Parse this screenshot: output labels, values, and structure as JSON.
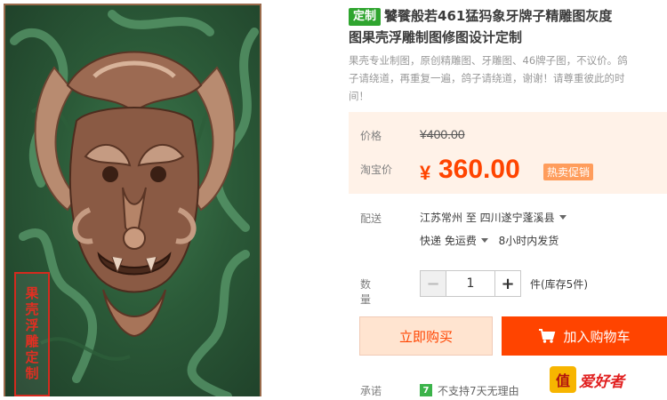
{
  "product": {
    "image_alt": "饕餮般若461猛犸象牙牌子精雕图",
    "stamp_text": "果壳浮雕定制",
    "tag": "定制",
    "title_line1": "饕餮般若461猛犸象牙牌子精雕图灰度",
    "title_line2": "图果壳浮雕制图修图设计定制",
    "desc_line1": "果壳专业制图，原创精雕图、牙雕图、46牌子图，不议价。鸽",
    "desc_line2": "子请绕道，再重复一遍，鸽子请绕道，谢谢！请尊重彼此的时",
    "desc_line3": "间！"
  },
  "price": {
    "label_price": "价格",
    "original": "¥400.00",
    "label_taobao": "淘宝价",
    "currency": "¥",
    "current": "360.00",
    "hot_badge": "热卖促销"
  },
  "shipping": {
    "label": "配送",
    "route": "江苏常州 至  四川遂宁蓬溪县",
    "method": "快递 免运费",
    "dispatch": "8小时内发货"
  },
  "quantity": {
    "label": "数量",
    "minus": "−",
    "value": "1",
    "plus": "+",
    "stock": "件(库存5件)"
  },
  "actions": {
    "buy_now": "立即购买",
    "add_cart": "加入购物车"
  },
  "promise": {
    "label": "承诺",
    "icon": "7",
    "text": "不支持7天无理由"
  },
  "watermark": {
    "badge": "值",
    "text": "爱好者"
  },
  "colors": {
    "accent": "#ff4400",
    "tag_green": "#2fa52f",
    "price_bg": "#fff2e8"
  }
}
